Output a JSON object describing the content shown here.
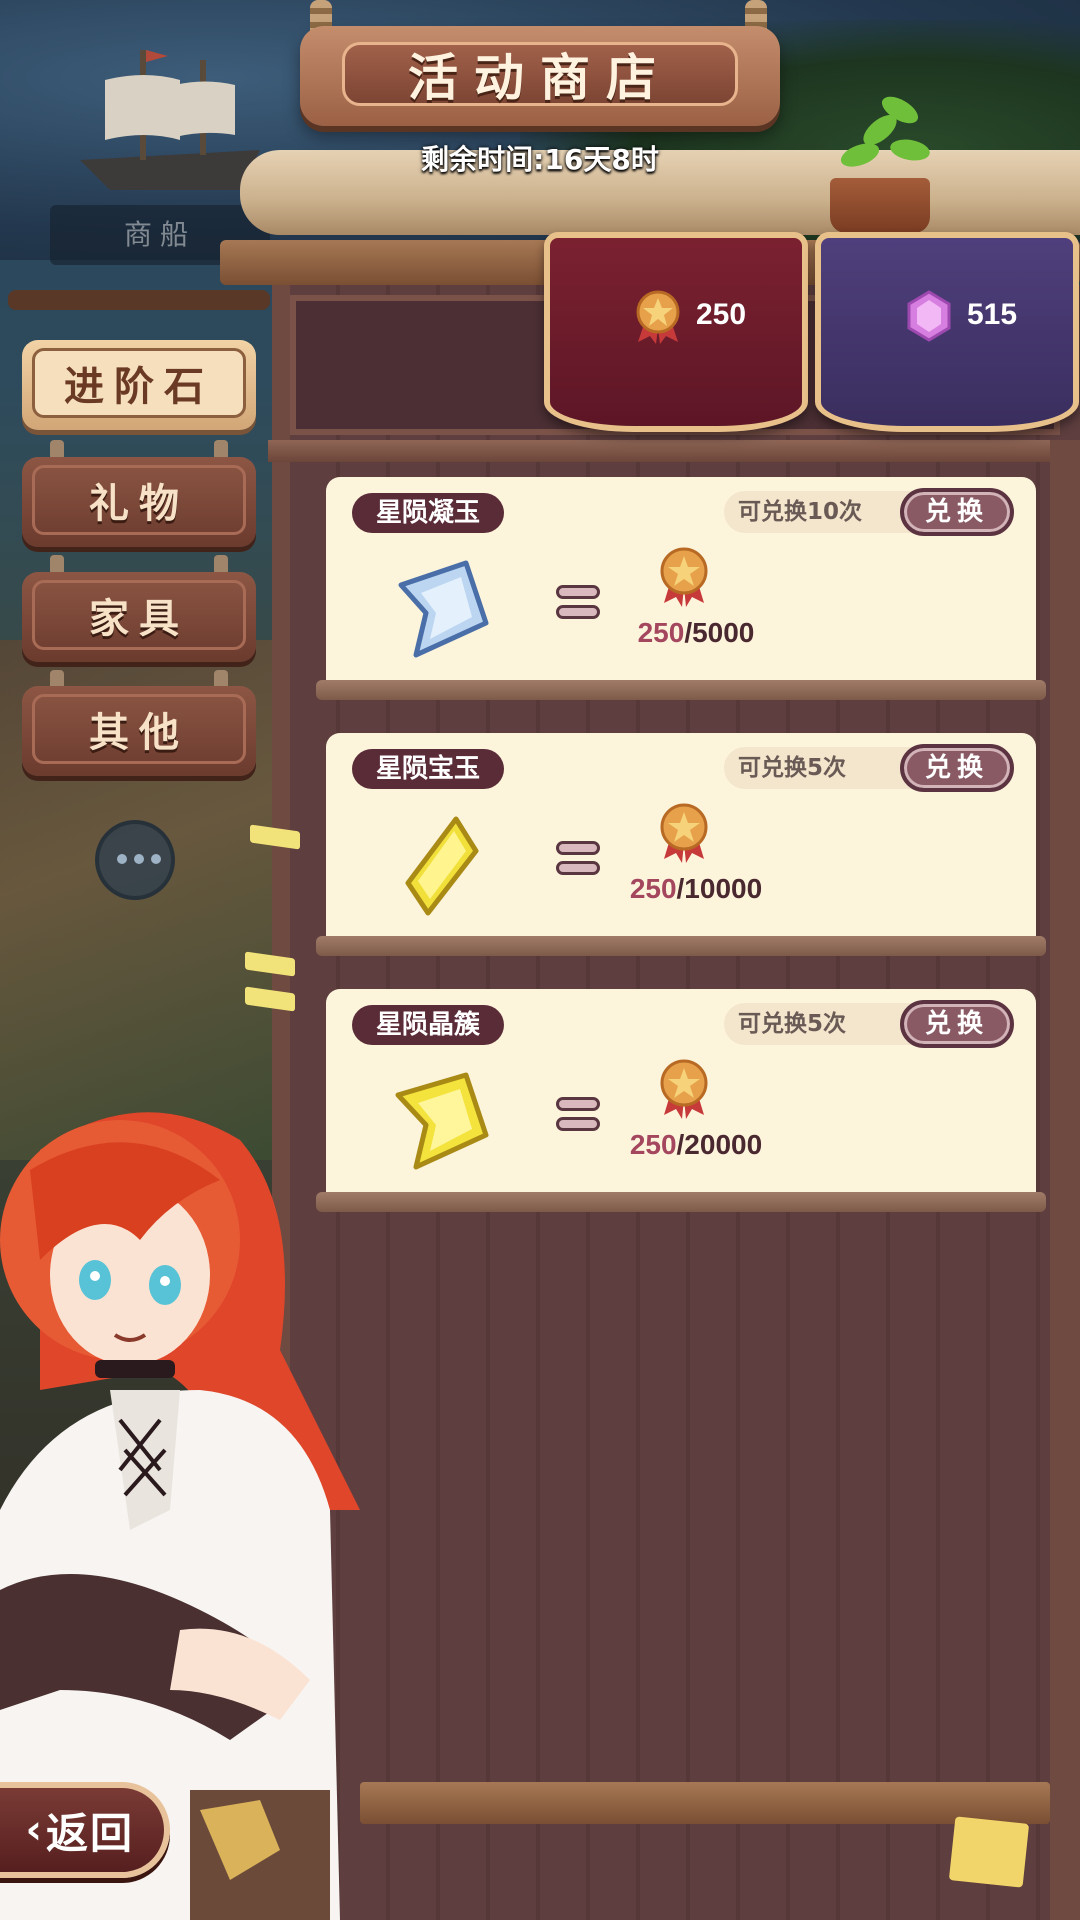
{
  "shop_title": "活动商店",
  "timer": "剩余时间:16天8时",
  "background": {
    "ship_label": "商船"
  },
  "currencies": [
    {
      "name": "medal-currency",
      "amount": "250"
    },
    {
      "name": "crystal-currency",
      "amount": "515"
    }
  ],
  "categories": [
    {
      "label": "进阶石",
      "active": true
    },
    {
      "label": "礼物",
      "active": false
    },
    {
      "label": "家具",
      "active": false
    },
    {
      "label": "其他",
      "active": false
    }
  ],
  "items": [
    {
      "name": "星陨凝玉",
      "limit": "可兑换10次",
      "button": "兑换",
      "owned": "250",
      "cost": "/5000",
      "icon": "blue-star-gem-icon"
    },
    {
      "name": "星陨宝玉",
      "limit": "可兑换5次",
      "button": "兑换",
      "owned": "250",
      "cost": "/10000",
      "icon": "yellow-crystal-icon"
    },
    {
      "name": "星陨晶簇",
      "limit": "可兑换5次",
      "button": "兑换",
      "owned": "250",
      "cost": "/20000",
      "icon": "yellow-star-gem-icon"
    }
  ],
  "back_button": {
    "label": "返回"
  },
  "colors": {
    "owned_amount": "#a4475e",
    "card_bg": "#fdf4dc",
    "tag_bg": "#5a2c38"
  }
}
